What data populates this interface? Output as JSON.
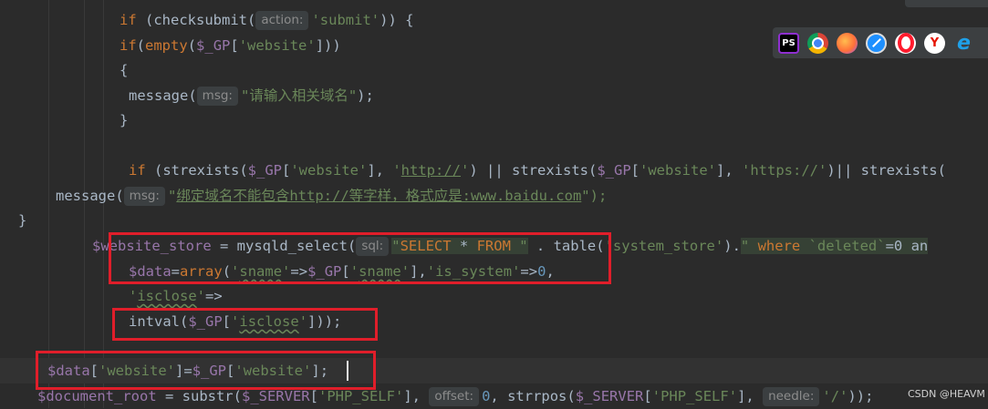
{
  "editor": {
    "lines": [
      [
        {
          "t": "if",
          "c": "kw"
        },
        {
          "t": " (",
          "c": "plain"
        },
        {
          "t": "checksubmit",
          "c": "plain"
        },
        {
          "t": "(",
          "c": "plain"
        },
        {
          "t": "action:",
          "c": "hint"
        },
        {
          "t": "'submit'",
          "c": "str"
        },
        {
          "t": ")) {",
          "c": "plain"
        }
      ],
      [
        {
          "t": "if",
          "c": "kw"
        },
        {
          "t": "(",
          "c": "plain"
        },
        {
          "t": "empty",
          "c": "kw"
        },
        {
          "t": "(",
          "c": "plain"
        },
        {
          "t": "$_GP",
          "c": "var"
        },
        {
          "t": "[",
          "c": "plain"
        },
        {
          "t": "'website'",
          "c": "str"
        },
        {
          "t": "]))",
          "c": "plain"
        }
      ],
      [
        {
          "t": "{",
          "c": "plain"
        }
      ],
      [
        {
          "t": "message",
          "c": "plain"
        },
        {
          "t": "(",
          "c": "plain"
        },
        {
          "t": "msg:",
          "c": "hint"
        },
        {
          "t": "\"请输入相关域名\"",
          "c": "str"
        },
        {
          "t": ");",
          "c": "plain"
        }
      ],
      [
        {
          "t": "}",
          "c": "plain"
        }
      ],
      [],
      [
        {
          "t": "if",
          "c": "kw"
        },
        {
          "t": " (strexists(",
          "c": "plain"
        },
        {
          "t": "$_GP",
          "c": "var"
        },
        {
          "t": "[",
          "c": "plain"
        },
        {
          "t": "'website'",
          "c": "str"
        },
        {
          "t": "], ",
          "c": "plain"
        },
        {
          "t": "'",
          "c": "str"
        },
        {
          "t": "http://",
          "c": "url"
        },
        {
          "t": "'",
          "c": "str"
        },
        {
          "t": ") || strexists(",
          "c": "plain"
        },
        {
          "t": "$_GP",
          "c": "var"
        },
        {
          "t": "[",
          "c": "plain"
        },
        {
          "t": "'website'",
          "c": "str"
        },
        {
          "t": "], ",
          "c": "plain"
        },
        {
          "t": "'https://'",
          "c": "str"
        },
        {
          "t": ")|| strexists(",
          "c": "plain"
        }
      ],
      [
        {
          "t": "message",
          "c": "plain"
        },
        {
          "t": "(",
          "c": "plain"
        },
        {
          "t": "msg:",
          "c": "hint"
        },
        {
          "t": "\"",
          "c": "str"
        },
        {
          "t": "绑定域名不能包含http://等字样，格式应是:www.baidu.com",
          "c": "url"
        },
        {
          "t": "\");",
          "c": "str"
        }
      ],
      [
        {
          "t": "}",
          "c": "plain"
        }
      ],
      [
        {
          "t": "$website_store",
          "c": "var"
        },
        {
          "t": " = ",
          "c": "plain"
        },
        {
          "t": "mysqld_select",
          "c": "plain"
        },
        {
          "t": "(",
          "c": "plain"
        },
        {
          "t": "sql:",
          "c": "hint"
        },
        {
          "t": "\"",
          "c": "sqlstr"
        },
        {
          "t": "SELECT",
          "c": "sqlkw"
        },
        {
          "t": " * ",
          "c": "sqlplain"
        },
        {
          "t": "FROM",
          "c": "sqlkw"
        },
        {
          "t": " \"",
          "c": "sqlstr"
        },
        {
          "t": " . table(",
          "c": "plain"
        },
        {
          "t": "'system_store'",
          "c": "str"
        },
        {
          "t": ").",
          "c": "plain"
        },
        {
          "t": "\"",
          "c": "sqlstr"
        },
        {
          "t": " where ",
          "c": "sqlkw"
        },
        {
          "t": "`deleted`",
          "c": "sqlstr"
        },
        {
          "t": "=0 an",
          "c": "sqlplain"
        }
      ],
      [
        {
          "t": "$data",
          "c": "var"
        },
        {
          "t": "=",
          "c": "plain"
        },
        {
          "t": "array",
          "c": "kw"
        },
        {
          "t": "(",
          "c": "plain"
        },
        {
          "t": "'",
          "c": "str"
        },
        {
          "t": "sname",
          "c": "str typo"
        },
        {
          "t": "'",
          "c": "str"
        },
        {
          "t": "=>",
          "c": "plain"
        },
        {
          "t": "$_GP",
          "c": "var"
        },
        {
          "t": "[",
          "c": "plain"
        },
        {
          "t": "'",
          "c": "str"
        },
        {
          "t": "sname",
          "c": "str typo"
        },
        {
          "t": "'",
          "c": "str"
        },
        {
          "t": "],",
          "c": "plain"
        },
        {
          "t": "'is_system'",
          "c": "str"
        },
        {
          "t": "=>",
          "c": "plain"
        },
        {
          "t": "0",
          "c": "num"
        },
        {
          "t": ",",
          "c": "plain"
        }
      ],
      [
        {
          "t": "'",
          "c": "str"
        },
        {
          "t": "isclose",
          "c": "str typo"
        },
        {
          "t": "'",
          "c": "str"
        },
        {
          "t": "=>",
          "c": "plain"
        }
      ],
      [
        {
          "t": "intval",
          "c": "plain"
        },
        {
          "t": "(",
          "c": "plain"
        },
        {
          "t": "$_GP",
          "c": "var"
        },
        {
          "t": "[",
          "c": "plain"
        },
        {
          "t": "'",
          "c": "str"
        },
        {
          "t": "isclose",
          "c": "str typo"
        },
        {
          "t": "'",
          "c": "str"
        },
        {
          "t": "]));",
          "c": "plain"
        }
      ],
      [],
      [
        {
          "t": "$data",
          "c": "var"
        },
        {
          "t": "[",
          "c": "plain"
        },
        {
          "t": "'website'",
          "c": "str"
        },
        {
          "t": "]=",
          "c": "plain"
        },
        {
          "t": "$_GP",
          "c": "var"
        },
        {
          "t": "[",
          "c": "plain"
        },
        {
          "t": "'website'",
          "c": "str"
        },
        {
          "t": "];",
          "c": "plain"
        }
      ],
      [
        {
          "t": "$document_root",
          "c": "var"
        },
        {
          "t": " = substr(",
          "c": "plain"
        },
        {
          "t": "$_SERVER",
          "c": "var"
        },
        {
          "t": "[",
          "c": "plain"
        },
        {
          "t": "'PHP_SELF'",
          "c": "str"
        },
        {
          "t": "], ",
          "c": "plain"
        },
        {
          "t": "offset:",
          "c": "hint"
        },
        {
          "t": "0",
          "c": "num"
        },
        {
          "t": ", strrpos(",
          "c": "plain"
        },
        {
          "t": "$_SERVER",
          "c": "var"
        },
        {
          "t": "[",
          "c": "plain"
        },
        {
          "t": "'PHP_SELF'",
          "c": "str"
        },
        {
          "t": "], ",
          "c": "plain"
        },
        {
          "t": "needle:",
          "c": "hint"
        },
        {
          "t": "'/'",
          "c": "str"
        },
        {
          "t": "));",
          "c": "plain"
        }
      ]
    ]
  },
  "browser_icons": [
    {
      "name": "phpstorm-icon",
      "label": "PS",
      "color": "#8f2fd0"
    },
    {
      "name": "chrome-icon",
      "label": "",
      "color": "#2fa84f"
    },
    {
      "name": "firefox-icon",
      "label": "",
      "color": "#ff7139"
    },
    {
      "name": "safari-icon",
      "label": "",
      "color": "#1e90ff"
    },
    {
      "name": "opera-icon",
      "label": "",
      "color": "#ff1b2d"
    },
    {
      "name": "yandex-icon",
      "label": "Y",
      "color": "#ffffff"
    },
    {
      "name": "edge-icon",
      "label": "e",
      "color": "#0078d7"
    }
  ],
  "watermark": "CSDN @HEAVM"
}
